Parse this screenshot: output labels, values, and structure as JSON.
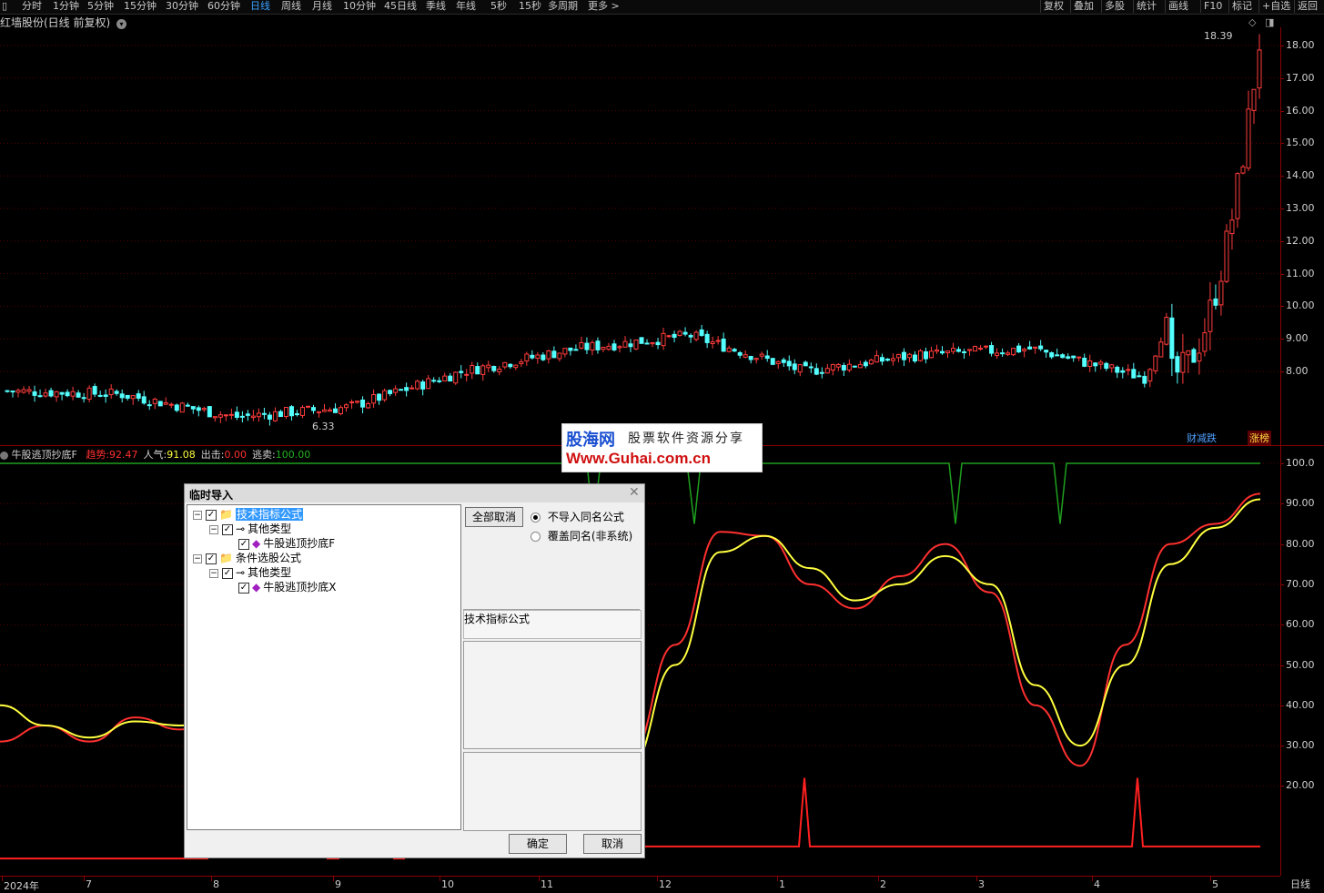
{
  "toolbar": {
    "periods": [
      "分时",
      "1分钟",
      "5分钟",
      "15分钟",
      "30分钟",
      "60分钟",
      "日线",
      "周线",
      "月线",
      "10分钟",
      "45日线",
      "季线",
      "年线",
      "5秒",
      "15秒",
      "多周期",
      "更多 >"
    ],
    "active_period": "日线",
    "right_tools": [
      "复权",
      "叠加",
      "多股",
      "统计",
      "画线",
      "F10",
      "标记",
      "+自选",
      "返回"
    ]
  },
  "stock_title": "红墙股份(日线 前复权)",
  "price_axis": [
    "18.00",
    "17.00",
    "16.00",
    "15.00",
    "14.00",
    "13.00",
    "12.00",
    "11.00",
    "10.00",
    "9.00",
    "8.00"
  ],
  "high_label": "18.39",
  "low_label": "6.33",
  "badges": {
    "left": "财减跌",
    "right": "涨榜"
  },
  "indicator": {
    "name": "牛股逃顶抄底F",
    "values": [
      {
        "label": "趋势:",
        "value": "92.47",
        "color": "#ff3030"
      },
      {
        "label": "人气:",
        "value": "91.08",
        "color": "#ffff40"
      },
      {
        "label": "出击:",
        "value": "0.00",
        "color": "#ff3030"
      },
      {
        "label": "逃卖:",
        "value": "100.00",
        "color": "#20b020"
      }
    ],
    "axis": [
      "100.0",
      "90.00",
      "80.00",
      "70.00",
      "60.00",
      "50.00",
      "40.00",
      "30.00",
      "20.00"
    ]
  },
  "x_axis": {
    "labels": [
      "2024年",
      "7",
      "8",
      "9",
      "10",
      "11",
      "12",
      "1",
      "2",
      "3",
      "4",
      "5"
    ],
    "corner_label": "日线"
  },
  "watermark": {
    "brand": "股海网",
    "slogan": "股票软件资源分享",
    "url": "Www.Guhai.com.cn"
  },
  "dialog": {
    "title": "临时导入",
    "tree": [
      {
        "label": "技术指标公式",
        "level": 0,
        "selected": true
      },
      {
        "label": "其他类型",
        "level": 1
      },
      {
        "label": "牛股逃顶抄底F",
        "level": 2
      },
      {
        "label": "条件选股公式",
        "level": 0
      },
      {
        "label": "其他类型",
        "level": 1
      },
      {
        "label": "牛股逃顶抄底X",
        "level": 2
      }
    ],
    "cancel_all_label": "全部取消",
    "radio_options": [
      "不导入同名公式",
      "覆盖同名(非系统)"
    ],
    "info_label": "技术指标公式",
    "ok_label": "确定",
    "cancel_label": "取消"
  },
  "chart_data": [
    {
      "type": "candlestick",
      "title": "红墙股份(日线 前复权)",
      "ylim": [
        6.0,
        18.5
      ],
      "x_range": [
        "2024-06",
        "2025-05"
      ],
      "close_series_approx": [
        {
          "x": "2024-06",
          "close": 7.4
        },
        {
          "x": "2024-07",
          "close": 7.3
        },
        {
          "x": "2024-08",
          "close": 6.6
        },
        {
          "x": "2024-09",
          "close": 6.9
        },
        {
          "x": "2024-10",
          "close": 8.0
        },
        {
          "x": "2024-11",
          "close": 8.7
        },
        {
          "x": "2024-12",
          "close": 9.1
        },
        {
          "x": "2025-01",
          "close": 8.0
        },
        {
          "x": "2025-02",
          "close": 8.5
        },
        {
          "x": "2025-03",
          "close": 8.7
        },
        {
          "x": "2025-04",
          "close": 7.8
        },
        {
          "x": "2025-05",
          "close": 17.2
        }
      ],
      "annotations": [
        "18.39",
        "6.33"
      ]
    },
    {
      "type": "line",
      "title": "牛股逃顶抄底F",
      "ylim": [
        0,
        100
      ],
      "series": [
        {
          "name": "趋势",
          "color": "#ff3030",
          "points": [
            31,
            35,
            31,
            37,
            34,
            38,
            27,
            22,
            16,
            75,
            87,
            82,
            40,
            16,
            28,
            55,
            83,
            82,
            70,
            64,
            72,
            80,
            68,
            40,
            25,
            55,
            80,
            85,
            92.47
          ]
        },
        {
          "name": "人气",
          "color": "#ffff40",
          "points": [
            40,
            35,
            32,
            36,
            35,
            36,
            30,
            24,
            20,
            72,
            86,
            84,
            50,
            20,
            25,
            50,
            78,
            82,
            74,
            66,
            70,
            77,
            70,
            45,
            30,
            50,
            75,
            84,
            91.08
          ]
        }
      ]
    }
  ]
}
